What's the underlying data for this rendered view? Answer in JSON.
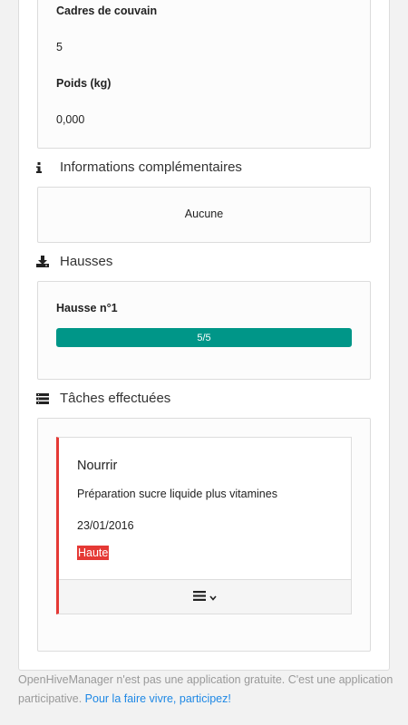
{
  "hive": {
    "brood_frames_label": "Cadres de couvain",
    "brood_frames_value": "5",
    "weight_label": "Poids (kg)",
    "weight_value": "0,000"
  },
  "additional_info": {
    "title": "Informations complémentaires",
    "value": "Aucune",
    "icon": "info-icon"
  },
  "supers": {
    "title": "Hausses",
    "icon": "download-icon",
    "items": [
      {
        "label": "Hausse n°1",
        "progress_text": "5/5",
        "progress_fraction": 1.0
      }
    ]
  },
  "tasks": {
    "title": "Tâches effectuées",
    "icon": "list-icon",
    "items": [
      {
        "title": "Nourrir",
        "description": "Préparation sucre liquide plus vitamines",
        "date": "23/01/2016",
        "priority": "Haute"
      }
    ]
  },
  "footer": {
    "text": "OpenHiveManager n'est pas une application gratuite. C'est une application participative.",
    "link": "Pour la faire vivre, participez!"
  },
  "colors": {
    "progress": "#009688",
    "priority_high": "#e53935",
    "link": "#1e88e5"
  }
}
